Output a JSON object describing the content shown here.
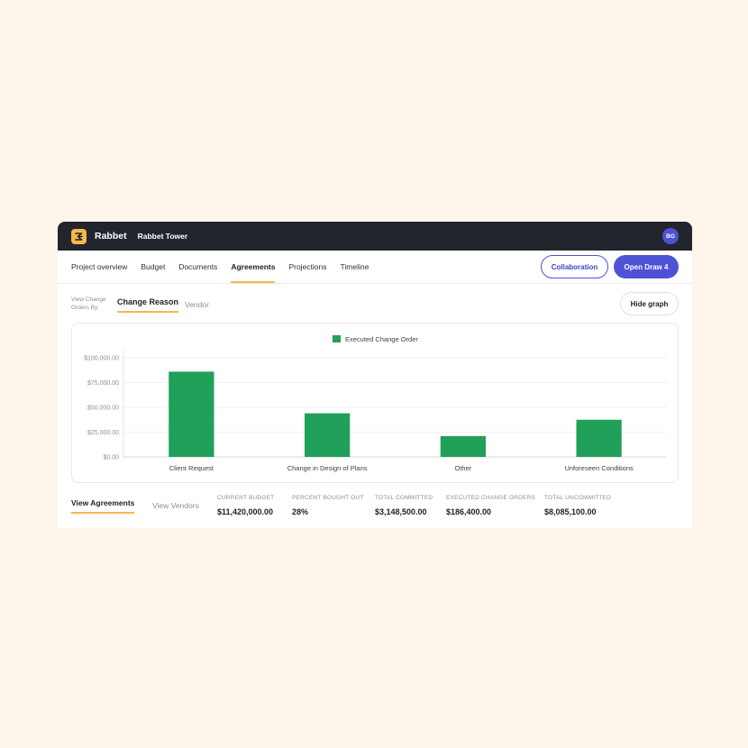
{
  "app": {
    "brand": "Rabbet",
    "project": "Rabbet Tower",
    "avatar_initials": "BG"
  },
  "nav": {
    "tabs": [
      {
        "label": "Project overview",
        "active": false
      },
      {
        "label": "Budget",
        "active": false
      },
      {
        "label": "Documents",
        "active": false
      },
      {
        "label": "Agreements",
        "active": true
      },
      {
        "label": "Projections",
        "active": false
      },
      {
        "label": "Timeline",
        "active": false
      }
    ],
    "collaboration_label": "Collaboration",
    "open_draw_label": "Open Draw 4"
  },
  "view_by": {
    "label": "View Change Orders By:",
    "options": [
      "Change Reason",
      "Vendor"
    ],
    "selected": "Change Reason",
    "hide_graph_label": "Hide graph"
  },
  "chart_data": {
    "type": "bar",
    "categories": [
      "Client Request",
      "Change in Design of Plans",
      "Other",
      "Unforeseen Conditions"
    ],
    "series": [
      {
        "name": "Executed Change Order",
        "values": [
          86000,
          44000,
          21000,
          37500
        ],
        "color": "#21a05a"
      }
    ],
    "y_ticks": [
      "$100,000.00",
      "$75,000.00",
      "$50,000.00",
      "$25,000.00",
      "$0.00"
    ],
    "ylim": [
      0,
      100000
    ],
    "grid": true,
    "legend_position": "top-center"
  },
  "summary": {
    "tabs": [
      "View Agreements",
      "View Vendors"
    ],
    "active_tab": "View Agreements",
    "metrics": [
      {
        "label": "CURRENT BUDGET",
        "value": "$11,420,000.00"
      },
      {
        "label": "PERCENT BOUGHT OUT",
        "value": "28%"
      },
      {
        "label": "TOTAL COMMITTED",
        "value": "$3,148,500.00"
      },
      {
        "label": "EXECUTED CHANGE ORDERS",
        "value": "$186,400.00"
      },
      {
        "label": "TOTAL UNCOMMITTED",
        "value": "$8,085,100.00"
      }
    ]
  },
  "colors": {
    "accent": "#4d52d6",
    "highlight": "#f6b84a",
    "bar": "#21a05a",
    "topbar": "#22252d",
    "page_background": "#fdf5ea"
  }
}
